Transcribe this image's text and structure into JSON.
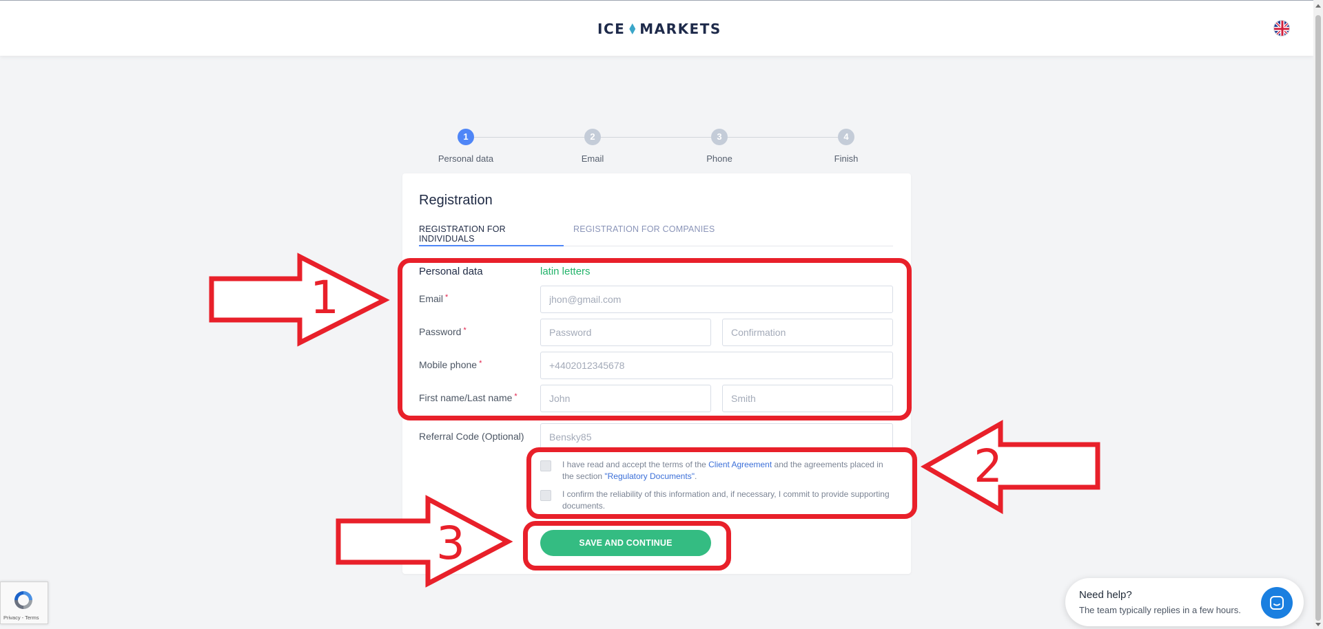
{
  "header": {
    "logo_left": "ICE",
    "logo_right": "MARKETS",
    "language_flag": "uk-flag-icon"
  },
  "stepper": {
    "steps": [
      {
        "number": "1",
        "label": "Personal data",
        "active": true
      },
      {
        "number": "2",
        "label": "Email",
        "active": false
      },
      {
        "number": "3",
        "label": "Phone",
        "active": false
      },
      {
        "number": "4",
        "label": "Finish",
        "active": false
      }
    ]
  },
  "form": {
    "title": "Registration",
    "tabs": [
      {
        "label": "REGISTRATION FOR INDIVIDUALS",
        "active": true
      },
      {
        "label": "REGISTRATION FOR COMPANIES",
        "active": false
      }
    ],
    "section_label": "Personal data",
    "section_hint": "latin letters",
    "required_marker": "*",
    "fields": {
      "email": {
        "label": "Email",
        "placeholder": "jhon@gmail.com",
        "value": ""
      },
      "password": {
        "label": "Password",
        "placeholder": "Password",
        "value": ""
      },
      "confirmation": {
        "placeholder": "Confirmation",
        "value": ""
      },
      "mobile": {
        "label": "Mobile phone",
        "placeholder": "+4402012345678",
        "value": ""
      },
      "first_last": {
        "label": "First name/Last name"
      },
      "first_name": {
        "placeholder": "John",
        "value": ""
      },
      "last_name": {
        "placeholder": "Smith",
        "value": ""
      },
      "referral": {
        "label": "Referral Code (Optional)",
        "placeholder": "",
        "value": "Bensky85"
      }
    },
    "consent1": {
      "pre": "I have read and accept the terms of the ",
      "link1": "Client Agreement",
      "mid": " and the agreements placed in the section ",
      "link2": "\"Regulatory Documents\"",
      "post": "."
    },
    "consent2": "I confirm the reliability of this information and, if necessary, I commit to provide supporting documents.",
    "submit_label": "SAVE AND CONTINUE"
  },
  "annotations": {
    "numbers": [
      "1",
      "2",
      "3"
    ],
    "color": "#e8202a"
  },
  "recaptcha": {
    "links": "Privacy - Terms"
  },
  "help_widget": {
    "title": "Need help?",
    "subtitle": "The team typically replies in a few hours."
  },
  "colors": {
    "accent_blue": "#4f86f7",
    "primary_green": "#34bc82",
    "hint_green": "#22b36a"
  }
}
